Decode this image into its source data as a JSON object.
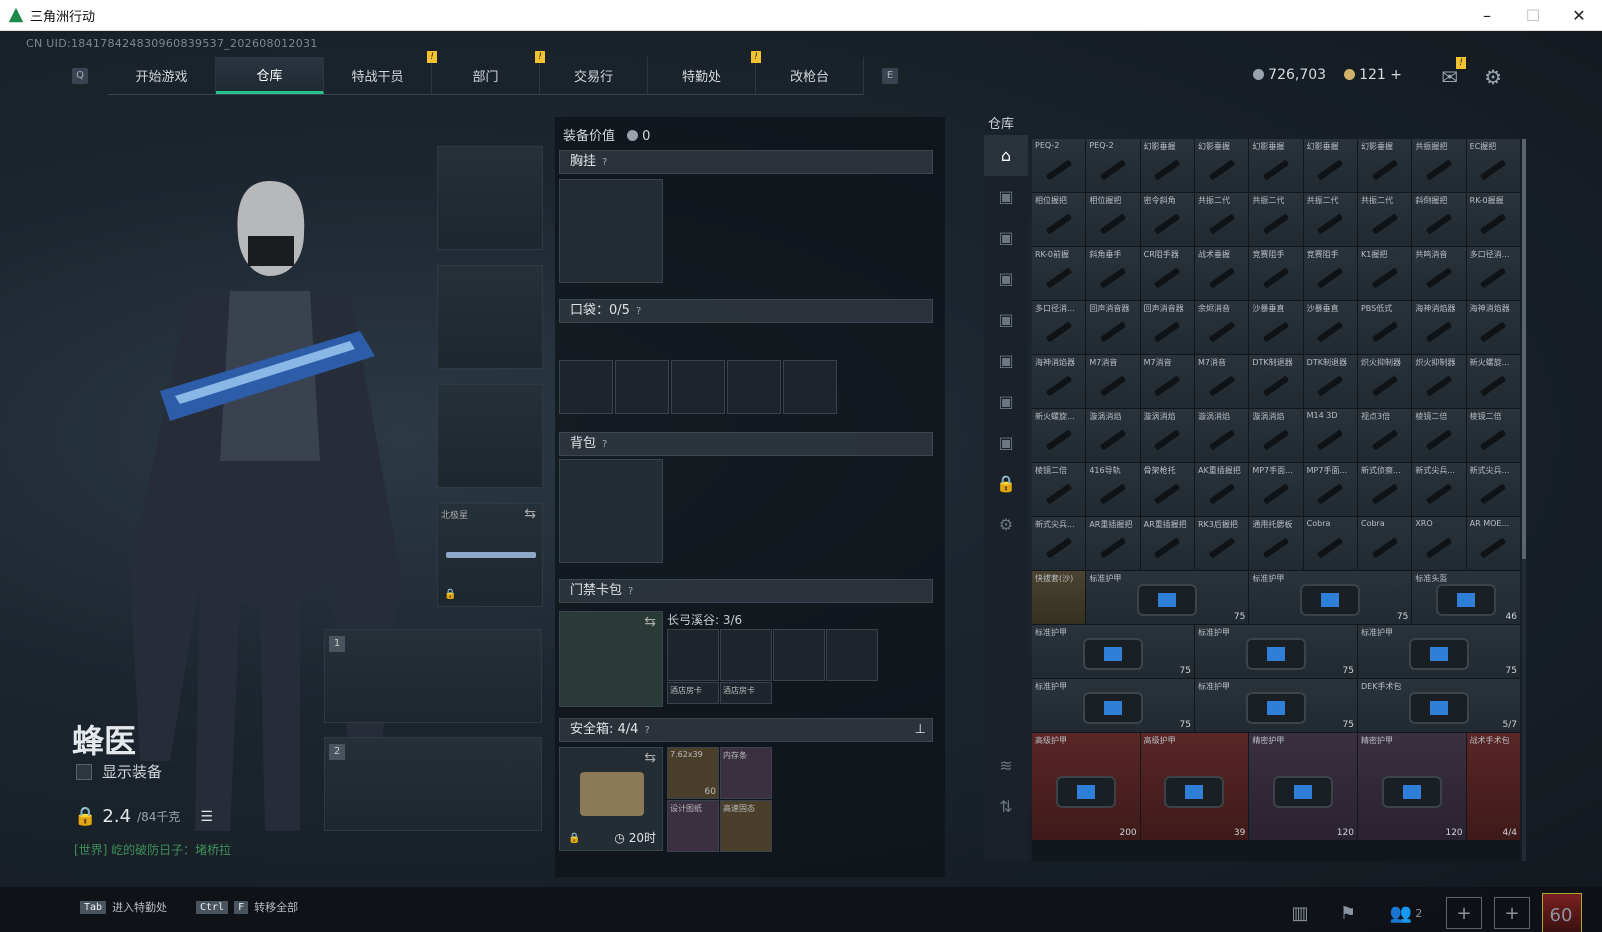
{
  "window": {
    "title": "三角洲行动"
  },
  "uid": "CN UID:18417842483096083953​7_202608012031",
  "nav": {
    "left_key": "Q",
    "right_key": "E",
    "tabs": [
      {
        "label": "开始游戏",
        "alert": ""
      },
      {
        "label": "仓库",
        "alert": ""
      },
      {
        "label": "特战干员",
        "alert": "!"
      },
      {
        "label": "部门",
        "alert": "!"
      },
      {
        "label": "交易行",
        "alert": ""
      },
      {
        "label": "特勤处",
        "alert": "!"
      },
      {
        "label": "改枪台",
        "alert": ""
      }
    ]
  },
  "currency": {
    "silver": "726,703",
    "gold": "121"
  },
  "character": {
    "name": "蜂医",
    "show_equipment": "显示装备",
    "weight": "2.4",
    "weight_max": "/84千克",
    "chat": "[世界] 屹的破防日子：堵桥拉"
  },
  "gear": {
    "secondary_name": "北极星",
    "slot1": "1",
    "slot2": "2"
  },
  "mid": {
    "equip_value_label": "装备价值",
    "equip_value": "0",
    "chest": "胸挂",
    "pocket": "口袋：0/5",
    "backpack": "背包",
    "keycard": "门禁卡包",
    "keycard_info": "长弓溪谷: 3/6",
    "keycard_cells": [
      "",
      "酒店房卡",
      "酒店房卡"
    ],
    "safe": "安全箱: 4/4",
    "safe_time": "20时",
    "safe_items": [
      "7.62x39",
      "内存条",
      "设计图纸",
      "高速固态"
    ],
    "safe_ammo": "60"
  },
  "warehouse": {
    "title": "仓库",
    "rows": [
      [
        "PEQ-2",
        "PEQ-2",
        "幻影垂握",
        "幻影垂握",
        "幻影垂握",
        "幻影垂握",
        "幻影垂握",
        "共振握把",
        "EC握把"
      ],
      [
        "相位握把",
        "相位握把",
        "密令斜角",
        "共振二代",
        "共振二代",
        "共振二代",
        "共振二代",
        "斜倒握把",
        "RK-0握握"
      ],
      [
        "RK-0前握",
        "斜角垂手",
        "CR阻手器",
        "战术垂握",
        "竞赛阻手",
        "竞赛阻手",
        "K1握把",
        "共鸣消音",
        "多口径消..."
      ],
      [
        "多口径消...",
        "回声消音器",
        "回声消音器",
        "余烬消音",
        "沙暴垂直",
        "沙暴垂直",
        "PBS低式",
        "海神消焰器",
        "海神消焰器"
      ],
      [
        "海神消焰器",
        "M7消音",
        "M7消音",
        "M7消音",
        "DTK制退器",
        "DTK制退器",
        "炽火抑制器",
        "炽火抑制器",
        "新火螺旋..."
      ],
      [
        "新火螺旋...",
        "漩涡消焰",
        "漩涡消焰",
        "漩涡消焰",
        "漩涡消焰",
        "M14 3D",
        "视点3倍",
        "棱镜二倍",
        "棱镜二倍"
      ],
      [
        "棱镜二倍",
        "416导轨",
        "骨架枪托",
        "AK重插握把",
        "MP7手面...",
        "MP7手面...",
        "新式侦察...",
        "新式尖兵...",
        "新式尖兵..."
      ],
      [
        "新式尖兵...",
        "AR重插握把",
        "AR重插握把",
        "RK3后握把",
        "通用托腮板",
        "Cobra",
        "Cobra",
        "XRO",
        "AR MOE..."
      ]
    ],
    "armor_rows": [
      [
        {
          "label": "快拔套(沙)",
          "span": 1,
          "tone": "gold",
          "dur": ""
        },
        {
          "label": "标准护甲",
          "span": 3,
          "tone": "",
          "dur": "75"
        },
        {
          "label": "标准护甲",
          "span": 3,
          "tone": "",
          "dur": "75"
        },
        {
          "label": "标准头盔",
          "span": 2,
          "tone": "",
          "dur": "46"
        }
      ],
      [
        {
          "label": "标准护甲",
          "span": 3,
          "tone": "",
          "dur": "75"
        },
        {
          "label": "标准护甲",
          "span": 3,
          "tone": "",
          "dur": "75"
        },
        {
          "label": "标准护甲",
          "span": 3,
          "tone": "",
          "dur": "75"
        }
      ],
      [
        {
          "label": "标准护甲",
          "span": 3,
          "tone": "",
          "dur": "75"
        },
        {
          "label": "标准护甲",
          "span": 3,
          "tone": "",
          "dur": "75"
        },
        {
          "label": "DEK手术包",
          "span": 3,
          "tone": "",
          "dur": "5/7"
        }
      ],
      [
        {
          "label": "高级护甲",
          "span": 2,
          "tone": "red",
          "dur": "200"
        },
        {
          "label": "高级护甲",
          "span": 2,
          "tone": "red",
          "dur": "39"
        },
        {
          "label": "精密护甲",
          "span": 2,
          "tone": "purple",
          "dur": "120"
        },
        {
          "label": "精密护甲",
          "span": 2,
          "tone": "purple",
          "dur": "120"
        },
        {
          "label": "战术手术包",
          "span": 1,
          "tone": "red",
          "dur": "4/4"
        }
      ]
    ]
  },
  "bottom": {
    "hint1_key": "Tab",
    "hint1": "进入特勤处",
    "hint2_key1": "Ctrl",
    "hint2_key2": "F",
    "hint2": "转移全部",
    "friends": "2",
    "level": "60"
  }
}
